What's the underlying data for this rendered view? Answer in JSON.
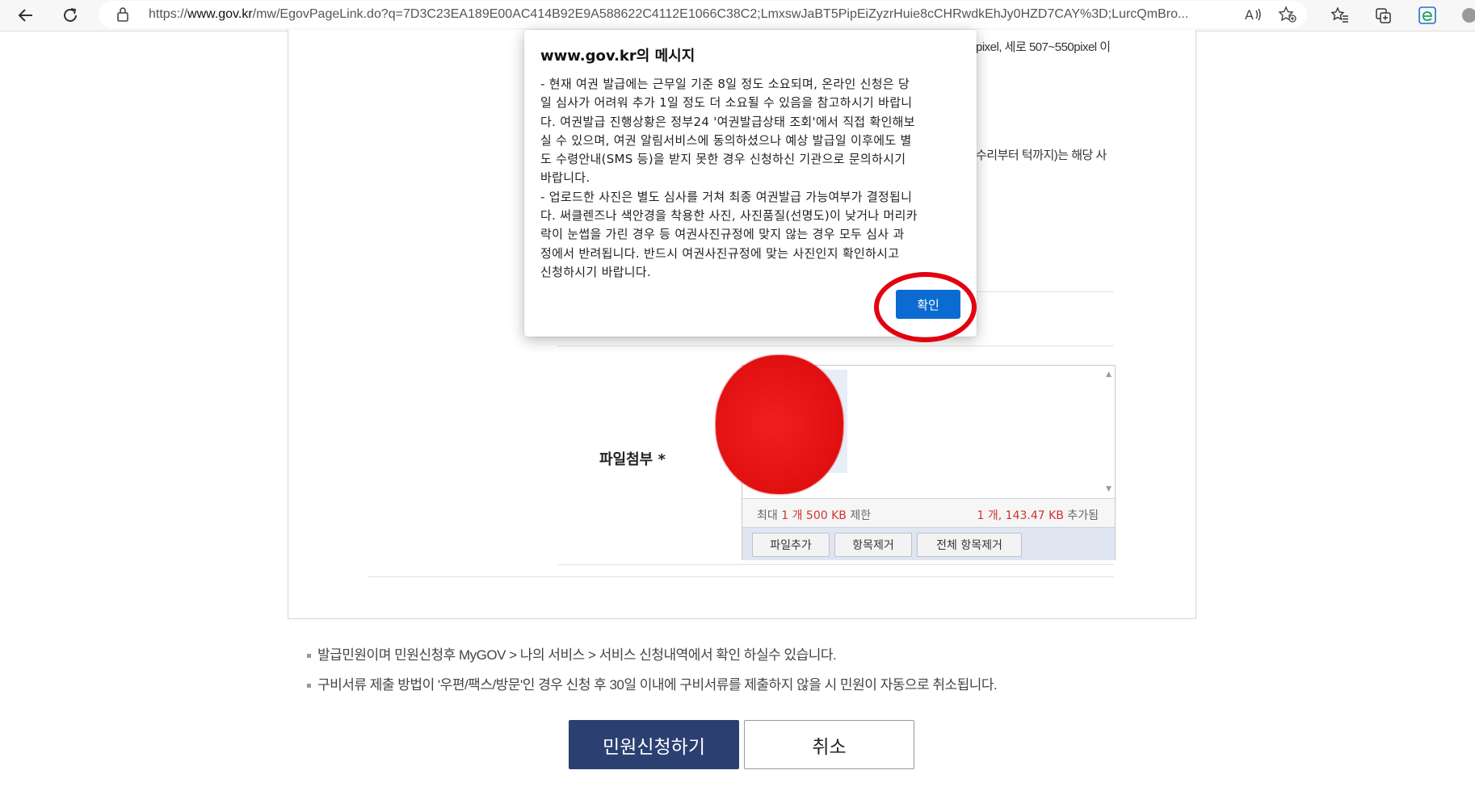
{
  "browser": {
    "url_scheme": "https://",
    "url_host": "www.gov.kr",
    "url_path": "/mw/EgovPageLink.do?q=7D3C23EA189E00AC414B92E9A588622C4112E1066C38C2;LmxswJaBT5PipEiZyzrHuie8cCHRwdkEhJy0HZD7CAY%3D;LurcQmBro..."
  },
  "background_text": {
    "line1": "pixel, 세로 507~550pixel 이",
    "line2": "수리부터 턱까지)는 해당 사"
  },
  "dialog": {
    "title": "www.gov.kr의 메시지",
    "body": "- 현재 여권 발급에는 근무일 기준 8일 정도 소요되며, 온라인 신청은 당\n일 심사가 어려워 추가 1일 정도 더 소요될 수 있음을 참고하시기 바랍니\n다. 여권발급 진행상황은 정부24 '여권발급상태 조회'에서 직접 확인해보\n실 수 있으며, 여권 알림서비스에 동의하셨으나 예상 발급일 이후에도 별\n도 수령안내(SMS 등)을 받지 못한 경우 신청하신 기관으로 문의하시기\n바랍니다.\n- 업로드한 사진은 별도 심사를 거쳐 최종 여권발급 가능여부가 결정됩니\n다. 써클렌즈나 색안경을 착용한 사진, 사진품질(선명도)이 낮거나 머리카\n락이 눈썹을 가린 경우 등 여권사진규정에 맞지 않는 경우 모두 심사 과\n정에서 반려됩니다. 반드시 여권사진규정에 맞는 사진인지 확인하시고\n신청하시기 바랍니다.",
    "ok_label": "확인"
  },
  "form": {
    "attach_label": "파일첨부 *",
    "limit_prefix": "최대",
    "limit_count": "1 개",
    "limit_size": "500 KB",
    "limit_suffix": "제한",
    "added_count": "1 개,",
    "added_size": "143.47 KB",
    "added_suffix": "추가됨",
    "btn_add": "파일추가",
    "btn_remove": "항목제거",
    "btn_remove_all": "전체 항목제거"
  },
  "notes": [
    "발급민원이며 민원신청후 MyGOV > 나의 서비스 > 서비스 신청내역에서 확인 하실수 있습니다.",
    "구비서류 제출 방법이 '우편/팩스/방문'인 경우 신청 후 30일 이내에 구비서류를 제출하지 않을 시 민원이 자동으로 취소됩니다."
  ],
  "actions": {
    "submit_label": "민원신청하기",
    "cancel_label": "취소"
  },
  "colors": {
    "dialog_button": "#0b6bd1",
    "submit_button": "#2b4071",
    "annotation_circle": "#e3000f",
    "redaction": "#e01010"
  },
  "icons": {
    "back": "arrow-left-icon",
    "reload": "reload-icon",
    "lock": "lock-icon",
    "read_aloud": "read-aloud-icon",
    "favorite_add": "star-add-icon",
    "favorites": "favorites-icon",
    "collections": "collections-icon",
    "edge": "edge-icon"
  }
}
